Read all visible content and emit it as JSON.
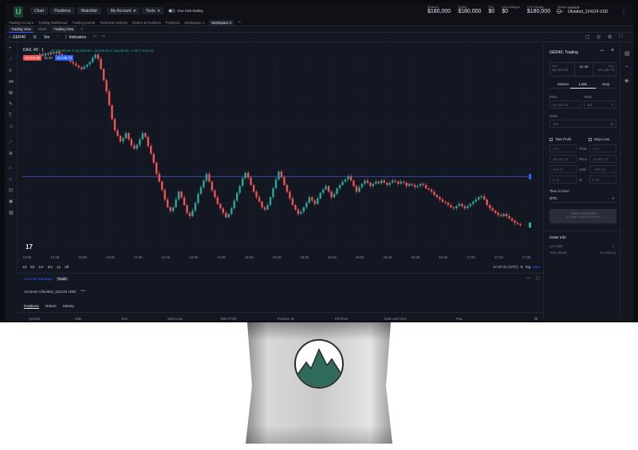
{
  "topbar": {
    "logo": "U",
    "nav": [
      "Chart",
      "Positions",
      "Watchlist"
    ],
    "account_select": "My Account",
    "tools_select": "Tools",
    "one_click": "One-click-trading",
    "stats": [
      {
        "label": "Balance",
        "value": "$180,000"
      },
      {
        "label": "Equity",
        "value": "$180,000"
      },
      {
        "label": "P&L",
        "value": "$0"
      },
      {
        "label": "Used Margin",
        "value": "$0"
      },
      {
        "label": "Free Margin",
        "value": "$180,000"
      },
      {
        "label": "Margin Level %",
        "value": "—"
      }
    ],
    "account_label": "Account",
    "account_value": "Ufunded_124124 USD"
  },
  "workspace_tabs": [
    "Trading Account",
    "Trading Dashboard",
    "Trading journal",
    "Technical Analysis",
    "Orders & Positions",
    "Positions",
    "Workspace 1",
    "Workspace 2"
  ],
  "view_tabs": [
    "Trading View",
    "Chart",
    "Trading View"
  ],
  "toolbar": {
    "symbol": "GER40",
    "interval": "5m",
    "indicators": "Indicators"
  },
  "legend": {
    "symbol": "DAX, 40 · 1",
    "ohlc": "O 19,108.00  H 19,108.00  L 19,106.00  C 19,106.00  −2.00 (−0.01%)",
    "sell_price": "19,104.00",
    "spread": "31.40",
    "buy_price": "19,135.72"
  },
  "chart_data": {
    "type": "candlestick",
    "x_ticks": [
      "13:00",
      "13:15",
      "13:30",
      "13:45",
      "14:00",
      "14:15",
      "14:30",
      "14:45",
      "15:00",
      "15:15",
      "15:30",
      "15:45",
      "16:00",
      "16:15",
      "16:30",
      "16:45",
      "17:00",
      "17:15",
      "17:30"
    ],
    "y_ticks": [
      19460,
      19440,
      19420,
      19400,
      19380,
      19360,
      19340,
      19320,
      19300,
      19280,
      19260,
      19240,
      19220,
      19200,
      19180,
      19160,
      19140,
      19120,
      19100
    ],
    "ylim": [
      19093,
      19465
    ],
    "price_line": 19227.16,
    "last_price": 19140,
    "up_color": "#26a69a",
    "down_color": "#ef5350",
    "closes": [
      19440,
      19442,
      19445,
      19443,
      19447,
      19444,
      19448,
      19446,
      19450,
      19448,
      19451,
      19447,
      19444,
      19440,
      19436,
      19433,
      19430,
      19426,
      19423,
      19420,
      19424,
      19428,
      19432,
      19440,
      19446,
      19438,
      19420,
      19400,
      19380,
      19355,
      19330,
      19310,
      19300,
      19290,
      19296,
      19305,
      19294,
      19283,
      19277,
      19284,
      19294,
      19305,
      19298,
      19282,
      19268,
      19252,
      19232,
      19218,
      19203,
      19186,
      19172,
      19165,
      19172,
      19186,
      19200,
      19190,
      19176,
      19162,
      19156,
      19166,
      19180,
      19196,
      19208,
      19220,
      19232,
      19218,
      19202,
      19190,
      19178,
      19170,
      19162,
      19154,
      19160,
      19170,
      19184,
      19198,
      19210,
      19224,
      19234,
      19225,
      19212,
      19200,
      19190,
      19182,
      19172,
      19168,
      19176,
      19190,
      19206,
      19222,
      19236,
      19226,
      19212,
      19200,
      19188,
      19176,
      19168,
      19160,
      19164,
      19172,
      19180,
      19190,
      19184,
      19178,
      19188,
      19198,
      19204,
      19210,
      19200,
      19190,
      19196,
      19206,
      19212,
      19218,
      19222,
      19228,
      19220,
      19210,
      19200,
      19208,
      19214,
      19220,
      19216,
      19210,
      19214,
      19218,
      19215,
      19220,
      19216,
      19212,
      19216,
      19220,
      19218,
      19214,
      19218,
      19216,
      19210,
      19214,
      19212,
      19208,
      19210,
      19214,
      19212,
      19206,
      19204,
      19200,
      19194,
      19190,
      19186,
      19182,
      19180,
      19176,
      19172,
      19170,
      19174,
      19178,
      19174,
      19170,
      19174,
      19178,
      19182,
      19186,
      19190,
      19192,
      19186,
      19176,
      19170,
      19166,
      19162,
      19158,
      19156,
      19160,
      19156,
      19152,
      19148,
      19144,
      19142,
      19140
    ]
  },
  "chart_footer": {
    "ranges": [
      "1d",
      "5d",
      "1m",
      "3m",
      "1y",
      "All"
    ],
    "time": "17:37:41 (UTC)",
    "pct": "%",
    "log": "log",
    "auto": "auto"
  },
  "bottom_panel": {
    "tabs": [
      "Account Manager",
      "Trade"
    ],
    "account": "Account: Ufunded_124124 USD",
    "sub_tabs": [
      "Positions",
      "Orders",
      "History"
    ],
    "columns": [
      "Symbol",
      "Side",
      "Size",
      "Stop Loss",
      "Take Profit",
      "Position ID",
      "Fill Price",
      "Date and Time",
      "P&L"
    ]
  },
  "order_panel": {
    "title": "GER40, Trading",
    "sell_label": "Sell",
    "sell_price": "19,104.00",
    "spread": "31.40",
    "buy_label": "Buy",
    "buy_price": "19,135.72",
    "order_types": [
      "Market",
      "Limit",
      "Stop"
    ],
    "price_label": "Price",
    "price_value": "19,104.00",
    "ticks_label": "Ticks",
    "ticks_value": "ask",
    "units_label": "Units",
    "units_value": "100",
    "take_profit": "Take Profit",
    "stop_loss": "Stop Loss",
    "tp_rows": [
      "Ticks",
      "Price",
      "USD",
      "%"
    ],
    "tp_values": [
      "75.0",
      "19,146.72",
      "403.13",
      "0.40"
    ],
    "sl_values": [
      "75.0",
      "19,060.72",
      "−403.13",
      "0.40"
    ],
    "tif_label": "Time in force",
    "tif_value": "GTC",
    "submit": "Select any field",
    "submit_sub": "to create order placement",
    "info_title": "Order Info",
    "info_rows": [
      {
        "k": "LOT SIZE",
        "v": "1"
      },
      {
        "k": "TICK VALUE",
        "v": "0.1 USD (1)"
      }
    ]
  }
}
